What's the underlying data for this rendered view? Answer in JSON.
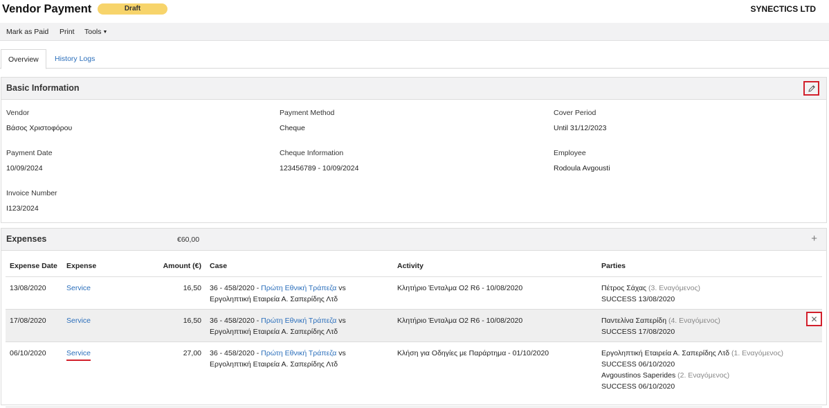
{
  "header": {
    "title": "Vendor Payment",
    "status": "Draft",
    "company": "SYNECTICS LTD"
  },
  "toolbar": {
    "mark_paid": "Mark as Paid",
    "print": "Print",
    "tools": "Tools"
  },
  "tabs": [
    {
      "label": "Overview"
    },
    {
      "label": "History Logs"
    }
  ],
  "basic": {
    "title": "Basic Information",
    "vendor_label": "Vendor",
    "vendor": "Βάσος Χριστοφόρου",
    "method_label": "Payment Method",
    "method": "Cheque",
    "cover_label": "Cover Period",
    "cover": "Until 31/12/2023",
    "date_label": "Payment Date",
    "date": "10/09/2024",
    "cheque_label": "Cheque Information",
    "cheque": "123456789 - 10/09/2024",
    "employee_label": "Employee",
    "employee": "Rodoula Avgousti",
    "invoice_label": "Invoice Number",
    "invoice": "I123/2024"
  },
  "expenses": {
    "title": "Expenses",
    "total": "€60,00",
    "columns": [
      "Expense Date",
      "Expense",
      "Amount (€)",
      "Case",
      "Activity",
      "Parties"
    ],
    "rows": [
      {
        "date": "13/08/2020",
        "expense": "Service",
        "amount": "16,50",
        "case_prefix": "36 - 458/2020 - ",
        "case_link": "Πρώτη Εθνική Τράπεζα",
        "case_vs": " vs",
        "case_line2": "Εργοληπτική Εταιρεία Α. Σαπερίδης Λτδ",
        "activity": "Κλητήριο Ένταλμα Ο2 R6 - 10/08/2020",
        "parties": [
          {
            "name": "Πέτρος Σάχας",
            "role": "(3. Εναγόμενος)",
            "status": "SUCCESS 13/08/2020"
          }
        ]
      },
      {
        "date": "17/08/2020",
        "expense": "Service",
        "amount": "16,50",
        "case_prefix": "36 - 458/2020 - ",
        "case_link": "Πρώτη Εθνική Τράπεζα",
        "case_vs": " vs",
        "case_line2": "Εργοληπτική Εταιρεία Α. Σαπερίδης Λτδ",
        "activity": "Κλητήριο Ένταλμα Ο2 R6 - 10/08/2020",
        "parties": [
          {
            "name": "Παντελίνα Σαπερίδη",
            "role": "(4. Εναγόμενος)",
            "status": "SUCCESS 17/08/2020"
          }
        ]
      },
      {
        "date": "06/10/2020",
        "expense": "Service",
        "amount": "27,00",
        "case_prefix": "36 - 458/2020 - ",
        "case_link": "Πρώτη Εθνική Τράπεζα",
        "case_vs": " vs",
        "case_line2": "Εργοληπτική Εταιρεία Α. Σαπερίδης Λτδ",
        "activity": "Κλήση για Οδηγίες με Παράρτημα - 01/10/2020",
        "parties": [
          {
            "name": "Εργοληπτική Εταιρεία Α. Σαπερίδης Λτδ",
            "role": "(1. Εναγόμενος)",
            "status": "SUCCESS 06/10/2020"
          },
          {
            "name": "Avgoustinos Saperides",
            "role": "(2. Εναγόμενος)",
            "status": "SUCCESS 06/10/2020"
          }
        ]
      }
    ]
  },
  "icons": {
    "edit": "pencil-icon",
    "add": "plus-icon",
    "remove": "close-icon",
    "tools_caret": "caret-down-icon"
  },
  "colors": {
    "badge": "#f7d46b",
    "link": "#2a6ebb",
    "highlight": "#d21f2b"
  }
}
